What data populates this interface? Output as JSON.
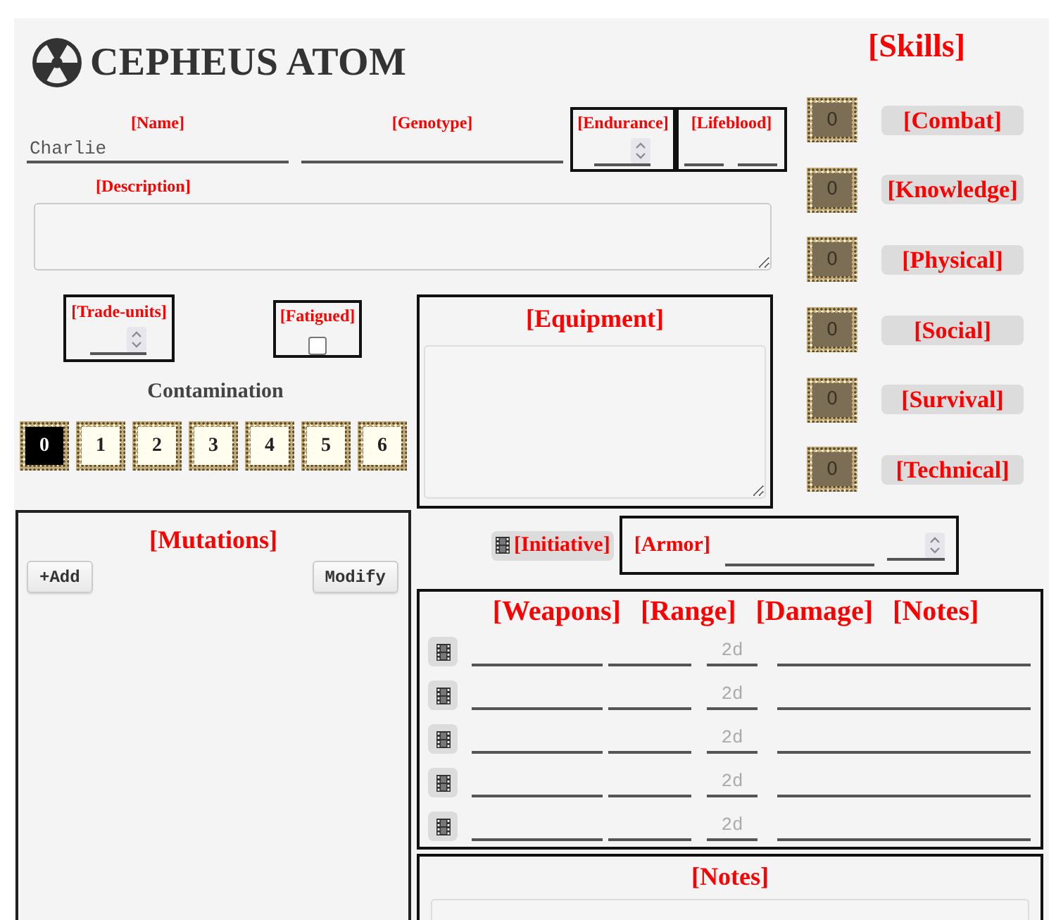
{
  "header": {
    "title": "CEPHEUS ATOM"
  },
  "identity": {
    "name": {
      "label": "[Name]",
      "value": "Charlie"
    },
    "genotype": {
      "label": "[Genotype]"
    },
    "endurance": {
      "label": "[Endurance]"
    },
    "lifeblood": {
      "label": "[Lifeblood]"
    },
    "description": {
      "label": "[Description]"
    }
  },
  "trade_units": {
    "label": "[Trade-units]"
  },
  "fatigued": {
    "label": "[Fatigued]",
    "checked": false
  },
  "contamination": {
    "title": "Contamination",
    "levels": [
      {
        "label": "0",
        "selected": true
      },
      {
        "label": "1",
        "selected": false
      },
      {
        "label": "2",
        "selected": false
      },
      {
        "label": "3",
        "selected": false
      },
      {
        "label": "4",
        "selected": false
      },
      {
        "label": "5",
        "selected": false
      },
      {
        "label": "6",
        "selected": false
      }
    ]
  },
  "equipment": {
    "label": "[Equipment]"
  },
  "skills": {
    "title": "[Skills]",
    "items": [
      {
        "rank": "0",
        "label": "[Combat]"
      },
      {
        "rank": "0",
        "label": "[Knowledge]"
      },
      {
        "rank": "0",
        "label": "[Physical]"
      },
      {
        "rank": "0",
        "label": "[Social]"
      },
      {
        "rank": "0",
        "label": "[Survival]"
      },
      {
        "rank": "0",
        "label": "[Technical]"
      }
    ]
  },
  "mutations": {
    "title": "[Mutations]",
    "buttons": [
      {
        "label": "+Add"
      },
      {
        "label": "Modify"
      }
    ]
  },
  "initiative": {
    "label": "[Initiative]"
  },
  "armor": {
    "label": "[Armor]"
  },
  "weapons": {
    "columns": [
      "[Weapons]",
      "[Range]",
      "[Damage]",
      "[Notes]"
    ],
    "rows": [
      {
        "damage_placeholder": "2d"
      },
      {
        "damage_placeholder": "2d"
      },
      {
        "damage_placeholder": "2d"
      },
      {
        "damage_placeholder": "2d"
      },
      {
        "damage_placeholder": "2d"
      }
    ]
  },
  "notes": {
    "label": "[Notes]"
  }
}
